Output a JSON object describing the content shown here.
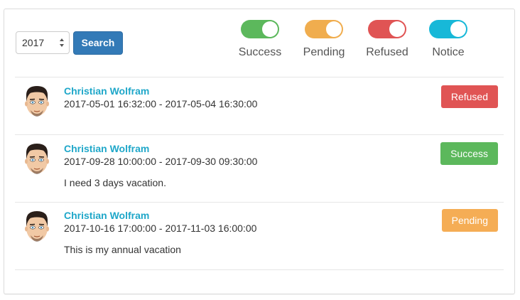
{
  "filter": {
    "year": "2017",
    "search_label": "Search"
  },
  "legend": [
    {
      "label": "Success",
      "color": "#5cb85c"
    },
    {
      "label": "Pending",
      "color": "#f0ad4e"
    },
    {
      "label": "Refused",
      "color": "#e05454"
    },
    {
      "label": "Notice",
      "color": "#17b8d8"
    }
  ],
  "requests": [
    {
      "name": "Christian Wolfram",
      "dates": "2017-05-01 16:32:00 - 2017-05-04 16:30:00",
      "note": "",
      "status": "Refused",
      "status_color": "#e05454"
    },
    {
      "name": "Christian Wolfram",
      "dates": "2017-09-28 10:00:00 - 2017-09-30 09:30:00",
      "note": "I need 3 days vacation.",
      "status": "Success",
      "status_color": "#5cb85c"
    },
    {
      "name": "Christian Wolfram",
      "dates": "2017-10-16 17:00:00 - 2017-11-03 16:00:00",
      "note": "This is my annual vacation",
      "status": "Pending",
      "status_color": "#f5ad55"
    }
  ]
}
